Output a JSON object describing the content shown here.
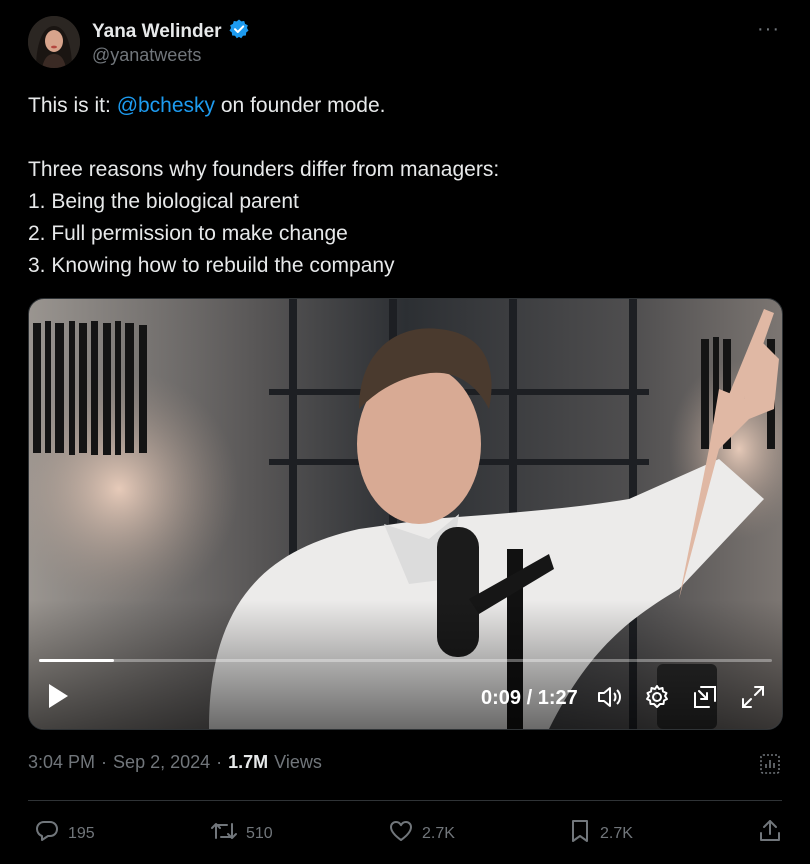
{
  "author": {
    "display_name": "Yana Welinder",
    "handle": "@yanatweets",
    "verified": true
  },
  "menu_icon": "ellipsis-icon",
  "tweet": {
    "line1_prefix": "This is it: ",
    "line1_mention": "@bchesky",
    "line1_suffix": " on founder mode.",
    "line2": "Three reasons why founders differ from managers:",
    "list": [
      "1. Being the biological parent",
      "2. Full permission to make change",
      "3. Knowing how to rebuild the company"
    ]
  },
  "video": {
    "current_time": "0:09",
    "duration": "1:27",
    "time_display": "0:09 / 1:27",
    "progress_fraction": 0.103
  },
  "meta": {
    "time": "3:04 PM",
    "date": "Sep 2, 2024",
    "views_count": "1.7M",
    "views_label": "Views",
    "sep": "·"
  },
  "actions": {
    "replies": "195",
    "reposts": "510",
    "likes": "2.7K",
    "bookmarks": "2.7K"
  },
  "colors": {
    "background": "#000000",
    "text": "#e7e9ea",
    "muted": "#71767b",
    "link": "#1d9bf0",
    "verified": "#1d9bf0"
  }
}
